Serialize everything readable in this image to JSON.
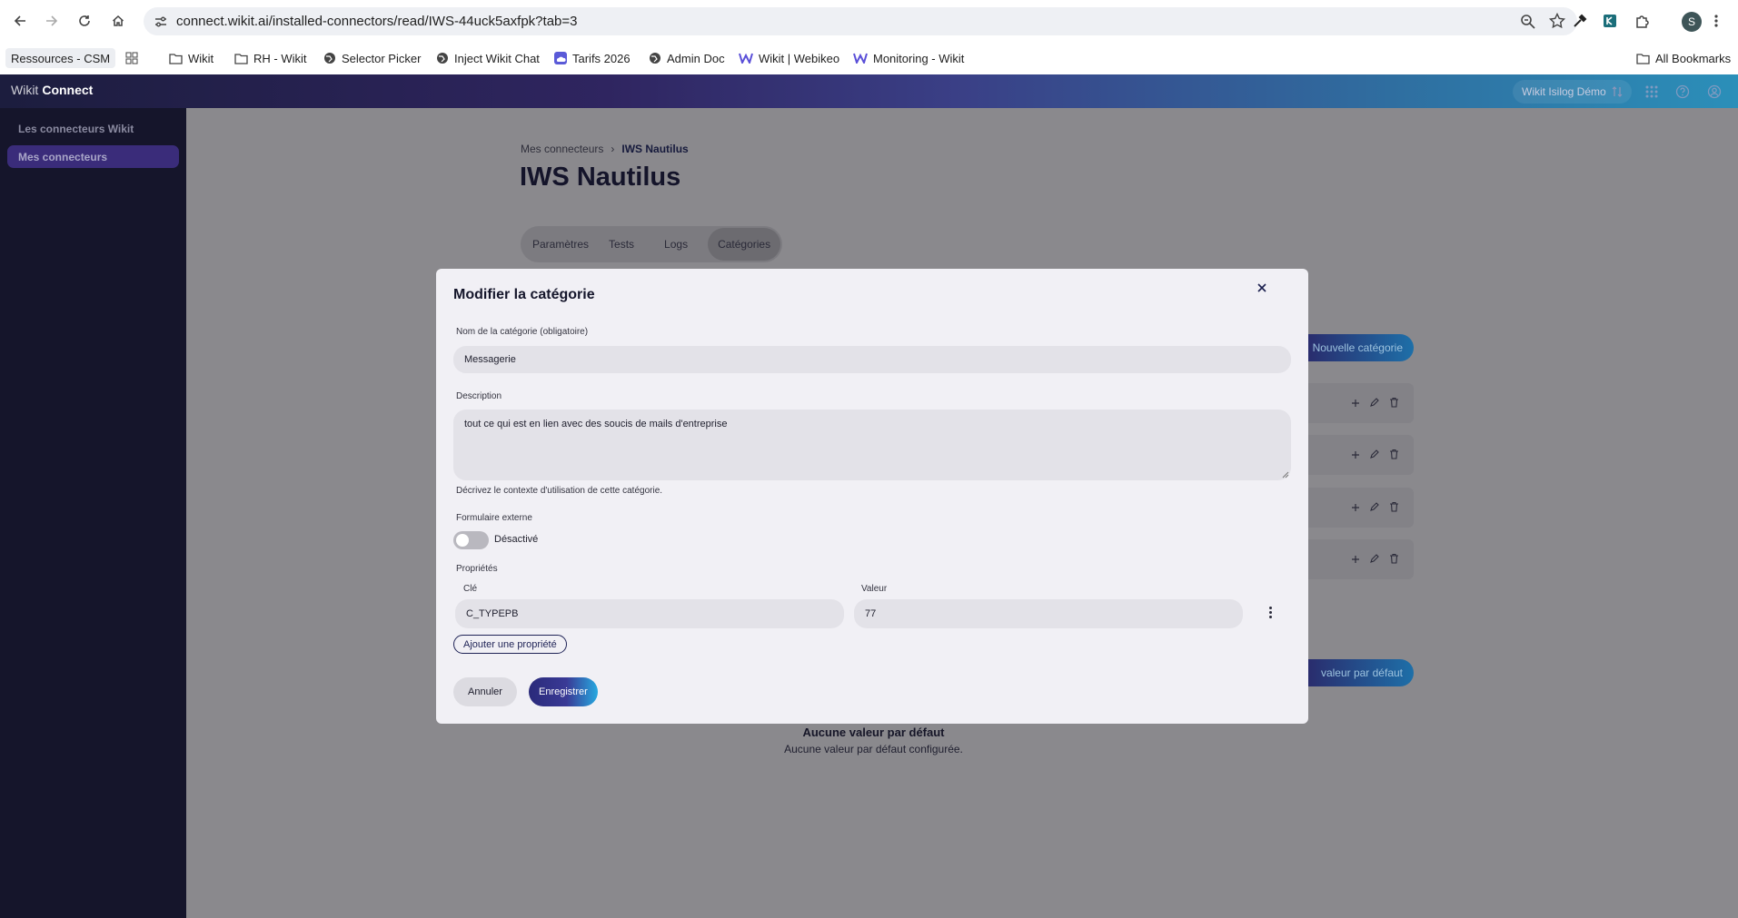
{
  "browser": {
    "url": "connect.wikit.ai/installed-connectors/read/IWS-44uck5axfpk?tab=3",
    "profile_initial": "S",
    "bookmarks": [
      {
        "label": "Ressources - CSM",
        "icon": "none"
      },
      {
        "label": "Wikit",
        "icon": "folder-icon"
      },
      {
        "label": "RH - Wikit",
        "icon": "folder-icon"
      },
      {
        "label": "Selector Picker",
        "icon": "globe-icon"
      },
      {
        "label": "Inject Wikit Chat",
        "icon": "globe-icon"
      },
      {
        "label": "Tarifs 2026",
        "icon": "cloud-icon"
      },
      {
        "label": "Admin Doc",
        "icon": "globe-icon"
      },
      {
        "label": "Wikit | Webikeo",
        "icon": "w-logo-icon"
      },
      {
        "label": "Monitoring - Wikit",
        "icon": "w-logo-icon"
      }
    ],
    "all_bookmarks": "All Bookmarks"
  },
  "app": {
    "brand_prefix": "Wikit",
    "brand_name": "Connect",
    "workspace": "Wikit Isilog Démo",
    "colors": {
      "accent": "#3a2c7a",
      "primary_dark": "#1f2356",
      "gradient_end": "#26a9e0"
    }
  },
  "sidebar": {
    "items": [
      {
        "label": "Les connecteurs Wikit",
        "active": false
      },
      {
        "label": "Mes connecteurs",
        "active": true
      }
    ]
  },
  "page": {
    "breadcrumb": [
      "Mes connecteurs",
      "IWS Nautilus"
    ],
    "title": "IWS Nautilus",
    "tabs": [
      {
        "label": "Paramètres",
        "active": false
      },
      {
        "label": "Tests",
        "active": false
      },
      {
        "label": "Logs",
        "active": false
      },
      {
        "label": "Catégories",
        "active": true
      }
    ],
    "new_category_button": "Nouvelle catégorie",
    "default_value_button": "valeur par défaut",
    "empty_title": "Aucune valeur par défaut",
    "empty_subtitle": "Aucune valeur par défaut configurée."
  },
  "modal": {
    "title": "Modifier la catégorie",
    "name_label": "Nom de la catégorie (obligatoire)",
    "name_value": "Messagerie",
    "description_label": "Description",
    "description_value": "tout ce qui est en lien avec des soucis de mails d'entreprise",
    "description_hint": "Décrivez le contexte d'utilisation de cette catégorie.",
    "external_form_label": "Formulaire externe",
    "external_form_state": "Désactivé",
    "external_form_enabled": false,
    "properties_label": "Propriétés",
    "key_label": "Clé",
    "value_label": "Valeur",
    "properties": [
      {
        "key": "C_TYPEPB",
        "value": "77"
      }
    ],
    "add_property": "Ajouter une propriété",
    "cancel": "Annuler",
    "save": "Enregistrer"
  }
}
